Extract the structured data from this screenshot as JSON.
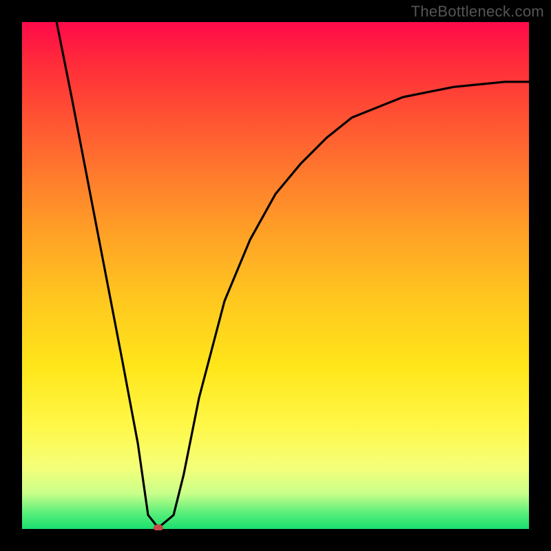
{
  "watermark": "TheBottleneck.com",
  "chart_data": {
    "type": "line",
    "title": "",
    "xlabel": "",
    "ylabel": "",
    "xlim": [
      0,
      100
    ],
    "ylim": [
      0,
      100
    ],
    "grid": false,
    "legend": false,
    "notes": "No axis ticks, labels, or numeric values are rendered in the image; values below are read off pixel positions within the gradient-filled plot area.",
    "series": [
      {
        "name": "curve",
        "x": [
          7,
          10,
          15,
          20,
          23,
          25,
          27,
          30,
          32,
          35,
          40,
          45,
          50,
          55,
          60,
          65,
          70,
          75,
          80,
          85,
          90,
          95,
          100
        ],
        "y": [
          100,
          85,
          59,
          33,
          17,
          3,
          0.5,
          3,
          11,
          26,
          45,
          57,
          66,
          72,
          77,
          81,
          83,
          85,
          86,
          87,
          87.5,
          88,
          88
        ]
      }
    ],
    "marker": {
      "x": 27,
      "y": 0.5,
      "color": "#c64a47",
      "shape": "ellipse"
    },
    "background_gradient": {
      "direction": "vertical",
      "stops": [
        {
          "pos": 0.0,
          "color": "#ff0a4a"
        },
        {
          "pos": 0.3,
          "color": "#ff7a2d"
        },
        {
          "pos": 0.55,
          "color": "#ffc81f"
        },
        {
          "pos": 0.8,
          "color": "#fff84a"
        },
        {
          "pos": 0.97,
          "color": "#55ee79"
        },
        {
          "pos": 1.0,
          "color": "#19df6e"
        }
      ]
    }
  }
}
